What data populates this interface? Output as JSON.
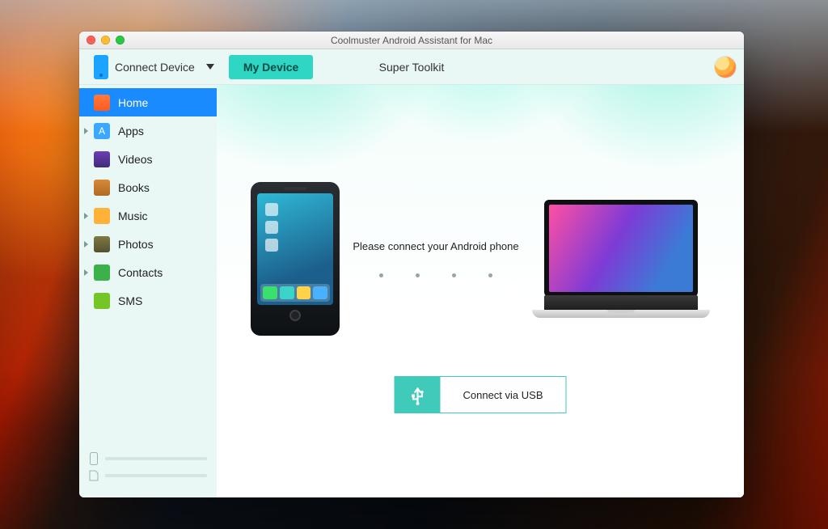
{
  "window": {
    "title": "Coolmuster Android Assistant for Mac"
  },
  "toolbar": {
    "connect_label": "Connect Device",
    "my_device_label": "My Device",
    "super_toolkit_label": "Super Toolkit"
  },
  "sidebar": {
    "items": [
      {
        "label": "Home",
        "icon": "home-icon",
        "active": true,
        "expandable": false
      },
      {
        "label": "Apps",
        "icon": "apps-icon",
        "active": false,
        "expandable": true
      },
      {
        "label": "Videos",
        "icon": "videos-icon",
        "active": false,
        "expandable": false
      },
      {
        "label": "Books",
        "icon": "books-icon",
        "active": false,
        "expandable": false
      },
      {
        "label": "Music",
        "icon": "music-icon",
        "active": false,
        "expandable": true
      },
      {
        "label": "Photos",
        "icon": "photos-icon",
        "active": false,
        "expandable": true
      },
      {
        "label": "Contacts",
        "icon": "contacts-icon",
        "active": false,
        "expandable": true
      },
      {
        "label": "SMS",
        "icon": "sms-icon",
        "active": false,
        "expandable": false
      }
    ]
  },
  "main": {
    "instruction": "Please connect your Android phone",
    "connect_button_label": "Connect via USB"
  },
  "colors": {
    "accent": "#3fcab9",
    "sidebar_bg": "#e9f7f5",
    "active_nav": "#1a8bff"
  }
}
